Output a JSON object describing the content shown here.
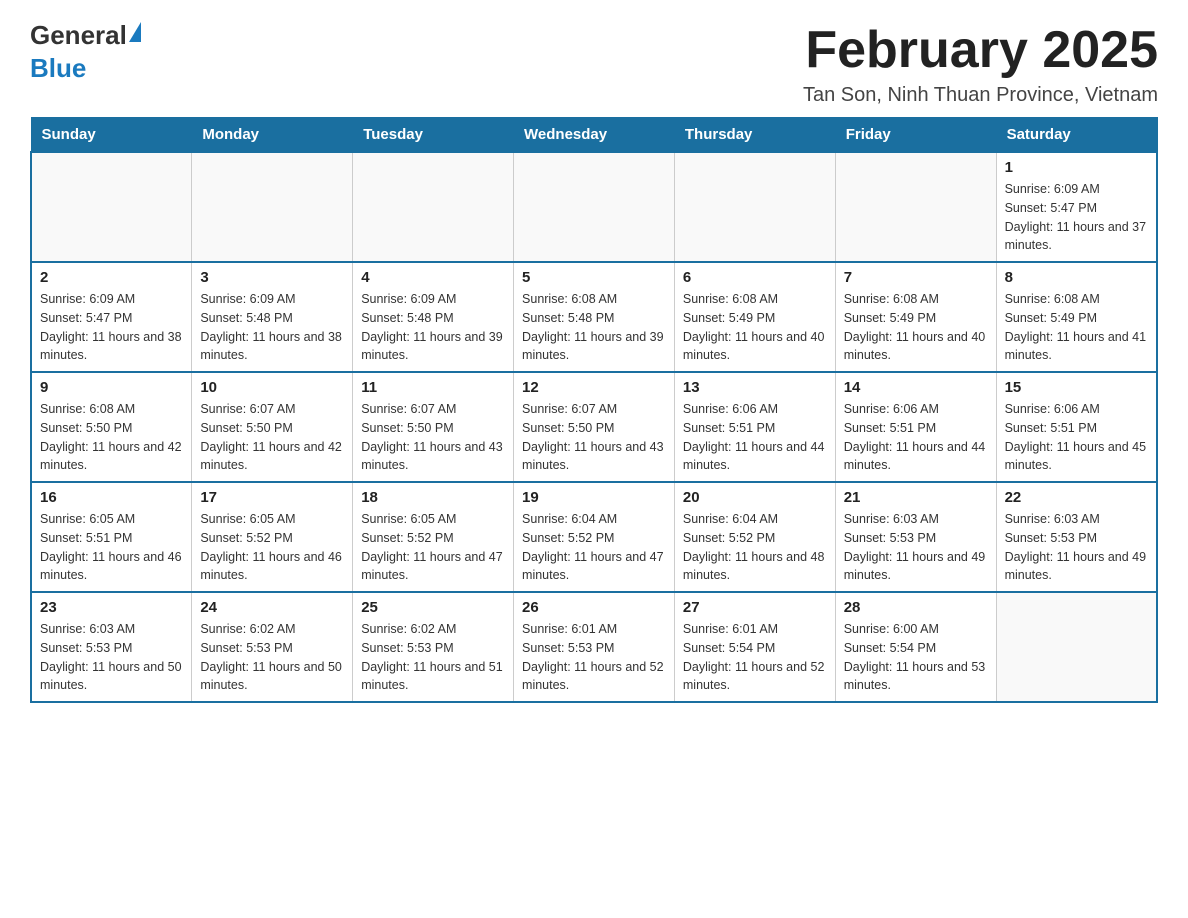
{
  "header": {
    "logo": {
      "general": "General",
      "blue": "Blue"
    },
    "title": "February 2025",
    "location": "Tan Son, Ninh Thuan Province, Vietnam"
  },
  "weekdays": [
    "Sunday",
    "Monday",
    "Tuesday",
    "Wednesday",
    "Thursday",
    "Friday",
    "Saturday"
  ],
  "weeks": [
    {
      "days": [
        {
          "num": "",
          "info": ""
        },
        {
          "num": "",
          "info": ""
        },
        {
          "num": "",
          "info": ""
        },
        {
          "num": "",
          "info": ""
        },
        {
          "num": "",
          "info": ""
        },
        {
          "num": "",
          "info": ""
        },
        {
          "num": "1",
          "info": "Sunrise: 6:09 AM\nSunset: 5:47 PM\nDaylight: 11 hours and 37 minutes."
        }
      ]
    },
    {
      "days": [
        {
          "num": "2",
          "info": "Sunrise: 6:09 AM\nSunset: 5:47 PM\nDaylight: 11 hours and 38 minutes."
        },
        {
          "num": "3",
          "info": "Sunrise: 6:09 AM\nSunset: 5:48 PM\nDaylight: 11 hours and 38 minutes."
        },
        {
          "num": "4",
          "info": "Sunrise: 6:09 AM\nSunset: 5:48 PM\nDaylight: 11 hours and 39 minutes."
        },
        {
          "num": "5",
          "info": "Sunrise: 6:08 AM\nSunset: 5:48 PM\nDaylight: 11 hours and 39 minutes."
        },
        {
          "num": "6",
          "info": "Sunrise: 6:08 AM\nSunset: 5:49 PM\nDaylight: 11 hours and 40 minutes."
        },
        {
          "num": "7",
          "info": "Sunrise: 6:08 AM\nSunset: 5:49 PM\nDaylight: 11 hours and 40 minutes."
        },
        {
          "num": "8",
          "info": "Sunrise: 6:08 AM\nSunset: 5:49 PM\nDaylight: 11 hours and 41 minutes."
        }
      ]
    },
    {
      "days": [
        {
          "num": "9",
          "info": "Sunrise: 6:08 AM\nSunset: 5:50 PM\nDaylight: 11 hours and 42 minutes."
        },
        {
          "num": "10",
          "info": "Sunrise: 6:07 AM\nSunset: 5:50 PM\nDaylight: 11 hours and 42 minutes."
        },
        {
          "num": "11",
          "info": "Sunrise: 6:07 AM\nSunset: 5:50 PM\nDaylight: 11 hours and 43 minutes."
        },
        {
          "num": "12",
          "info": "Sunrise: 6:07 AM\nSunset: 5:50 PM\nDaylight: 11 hours and 43 minutes."
        },
        {
          "num": "13",
          "info": "Sunrise: 6:06 AM\nSunset: 5:51 PM\nDaylight: 11 hours and 44 minutes."
        },
        {
          "num": "14",
          "info": "Sunrise: 6:06 AM\nSunset: 5:51 PM\nDaylight: 11 hours and 44 minutes."
        },
        {
          "num": "15",
          "info": "Sunrise: 6:06 AM\nSunset: 5:51 PM\nDaylight: 11 hours and 45 minutes."
        }
      ]
    },
    {
      "days": [
        {
          "num": "16",
          "info": "Sunrise: 6:05 AM\nSunset: 5:51 PM\nDaylight: 11 hours and 46 minutes."
        },
        {
          "num": "17",
          "info": "Sunrise: 6:05 AM\nSunset: 5:52 PM\nDaylight: 11 hours and 46 minutes."
        },
        {
          "num": "18",
          "info": "Sunrise: 6:05 AM\nSunset: 5:52 PM\nDaylight: 11 hours and 47 minutes."
        },
        {
          "num": "19",
          "info": "Sunrise: 6:04 AM\nSunset: 5:52 PM\nDaylight: 11 hours and 47 minutes."
        },
        {
          "num": "20",
          "info": "Sunrise: 6:04 AM\nSunset: 5:52 PM\nDaylight: 11 hours and 48 minutes."
        },
        {
          "num": "21",
          "info": "Sunrise: 6:03 AM\nSunset: 5:53 PM\nDaylight: 11 hours and 49 minutes."
        },
        {
          "num": "22",
          "info": "Sunrise: 6:03 AM\nSunset: 5:53 PM\nDaylight: 11 hours and 49 minutes."
        }
      ]
    },
    {
      "days": [
        {
          "num": "23",
          "info": "Sunrise: 6:03 AM\nSunset: 5:53 PM\nDaylight: 11 hours and 50 minutes."
        },
        {
          "num": "24",
          "info": "Sunrise: 6:02 AM\nSunset: 5:53 PM\nDaylight: 11 hours and 50 minutes."
        },
        {
          "num": "25",
          "info": "Sunrise: 6:02 AM\nSunset: 5:53 PM\nDaylight: 11 hours and 51 minutes."
        },
        {
          "num": "26",
          "info": "Sunrise: 6:01 AM\nSunset: 5:53 PM\nDaylight: 11 hours and 52 minutes."
        },
        {
          "num": "27",
          "info": "Sunrise: 6:01 AM\nSunset: 5:54 PM\nDaylight: 11 hours and 52 minutes."
        },
        {
          "num": "28",
          "info": "Sunrise: 6:00 AM\nSunset: 5:54 PM\nDaylight: 11 hours and 53 minutes."
        },
        {
          "num": "",
          "info": ""
        }
      ]
    }
  ]
}
